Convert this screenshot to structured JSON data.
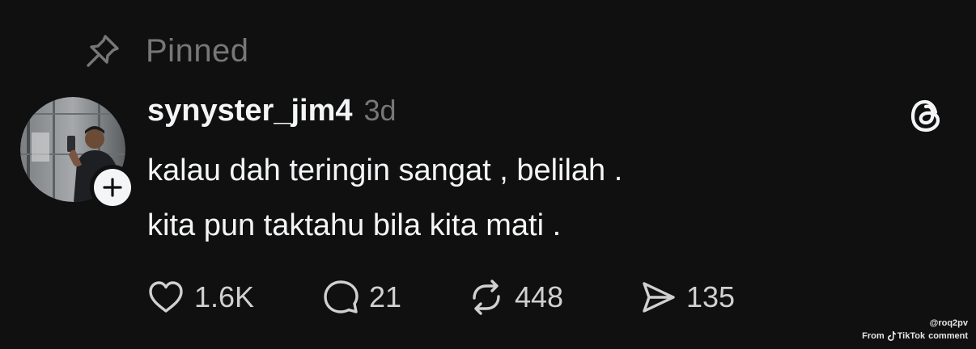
{
  "pinned": {
    "label": "Pinned",
    "icon": "pin-icon"
  },
  "post": {
    "username": "synyster_jim4",
    "time": "3d",
    "lines": [
      "kalau dah teringin sangat , belilah .",
      "kita pun taktahu bila kita mati ."
    ],
    "avatar_icon": "avatar-photo",
    "follow_icon": "plus-icon",
    "app_logo_icon": "threads-logo-icon"
  },
  "actions": {
    "likes": "1.6K",
    "replies": "21",
    "reposts": "448",
    "shares": "135"
  },
  "watermark": {
    "handle": "@roq2pv",
    "from": "From",
    "brand": "TikTok",
    "suffix": "comment"
  },
  "colors": {
    "background": "#101010",
    "primary_text": "#f3f5f7",
    "secondary_text": "#777777"
  }
}
